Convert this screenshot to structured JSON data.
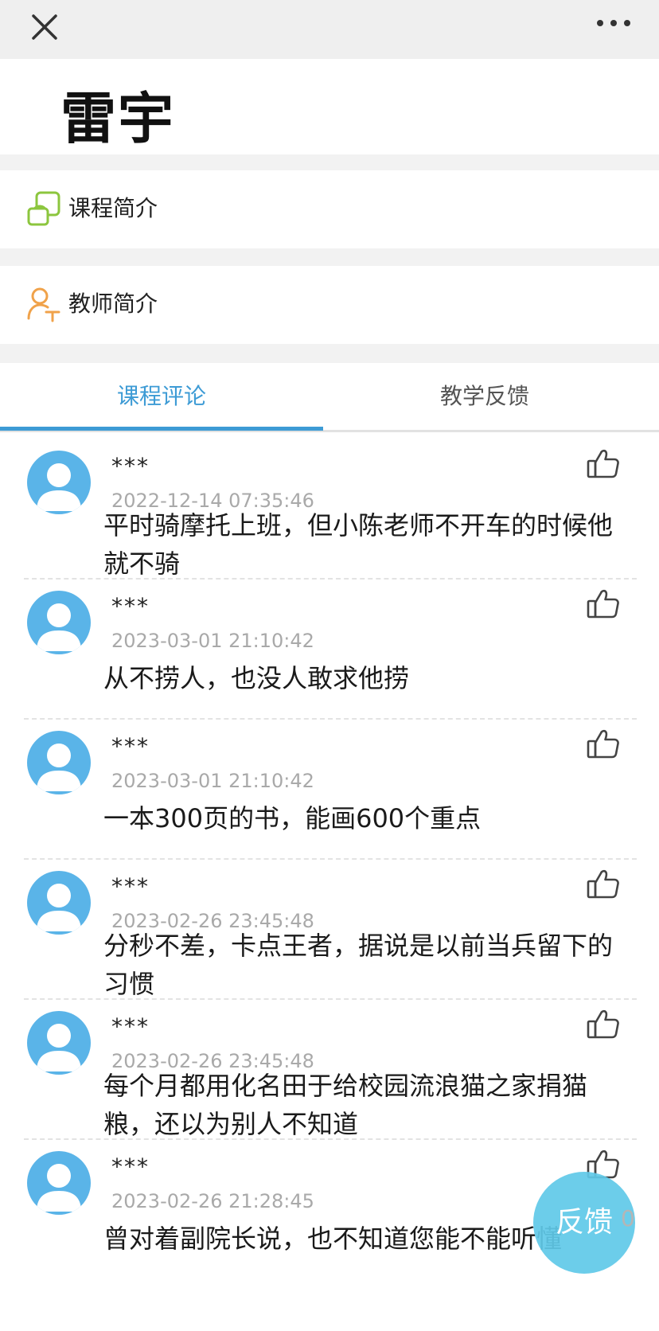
{
  "topbar": {
    "close_icon": "close-icon",
    "more_icon": "more-icon"
  },
  "teacher": {
    "name": "雷宇"
  },
  "menu": [
    {
      "label": "课程简介",
      "icon": "course-intro-icon",
      "color": "#8cc63e"
    },
    {
      "label": "教师简介",
      "icon": "teacher-intro-icon",
      "color": "#f0a24a"
    }
  ],
  "tabs": [
    {
      "label": "课程评论",
      "active": true
    },
    {
      "label": "教学反馈",
      "active": false
    }
  ],
  "colors": {
    "accent": "#3d9bd5",
    "avatar": "#5ab4e8",
    "fab": "#5fc9e8"
  },
  "comments": [
    {
      "user": "***",
      "time": "2022-12-14 07:35:46",
      "text": "平时骑摩托上班，但小陈老师不开车的时候他就不骑"
    },
    {
      "user": "***",
      "time": "2023-03-01 21:10:42",
      "text": "从不捞人，也没人敢求他捞"
    },
    {
      "user": "***",
      "time": "2023-03-01 21:10:42",
      "text": "一本300页的书，能画600个重点"
    },
    {
      "user": "***",
      "time": "2023-02-26 23:45:48",
      "text": "分秒不差，卡点王者，据说是以前当兵留下的习惯"
    },
    {
      "user": "***",
      "time": "2023-02-26 23:45:48",
      "text": "每个月都用化名田于给校园流浪猫之家捐猫粮，还以为别人不知道"
    },
    {
      "user": "***",
      "time": "2023-02-26 21:28:45",
      "text": "曾对着副院长说，也不知道您能不能听懂"
    }
  ],
  "feedback_button": {
    "label": "反馈",
    "count": "0"
  }
}
